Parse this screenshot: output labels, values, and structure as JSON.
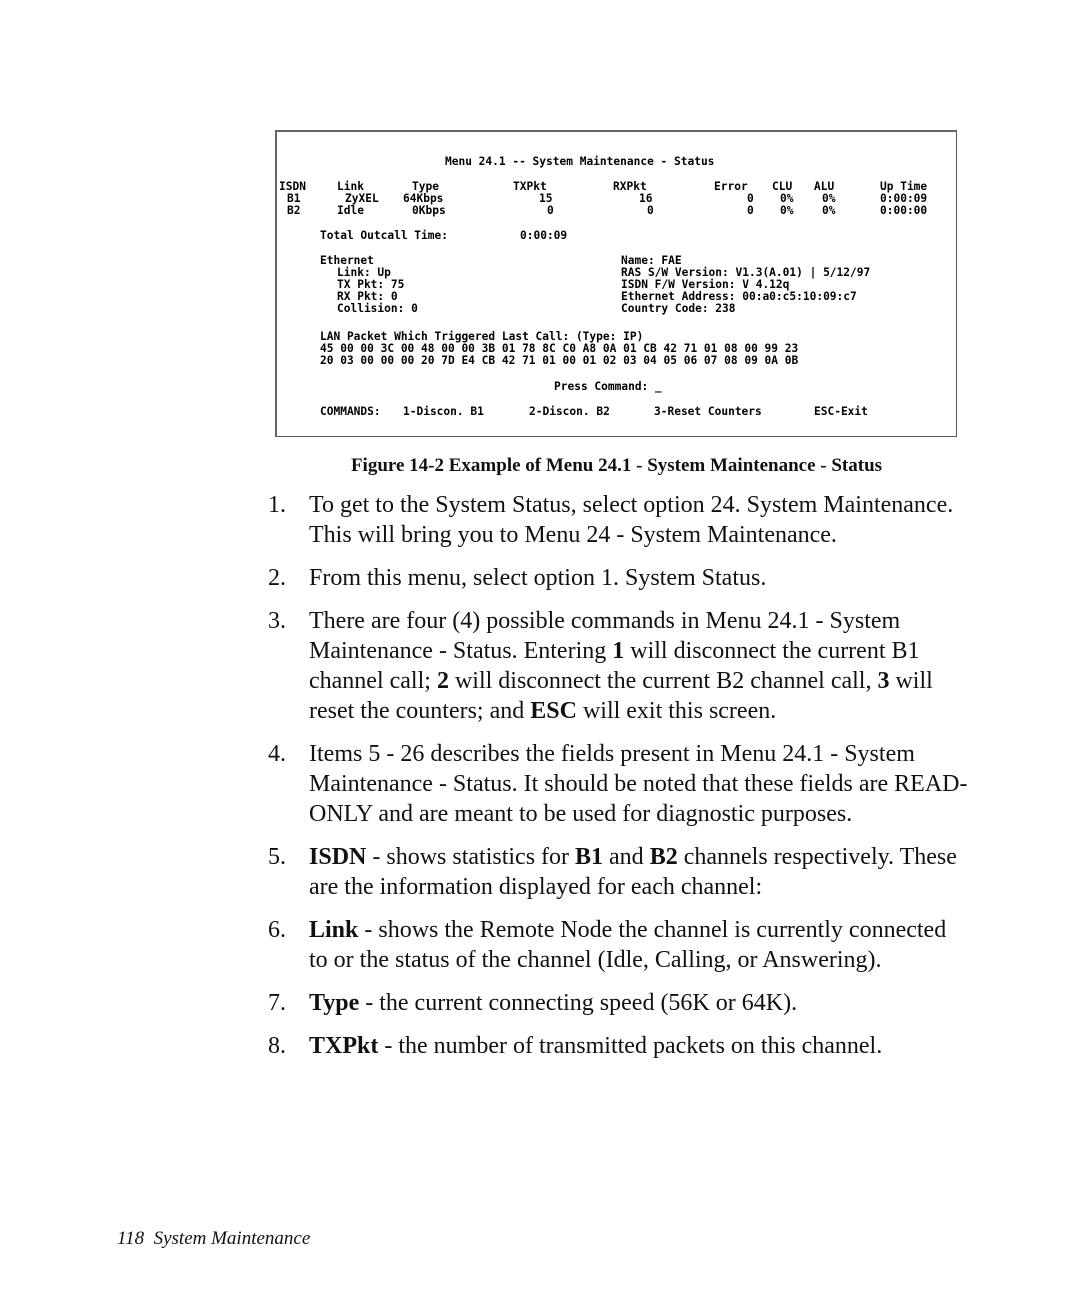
{
  "terminal": {
    "title": "Menu 24.1 -- System Maintenance - Status",
    "isdn_table": {
      "headers": [
        "ISDN",
        "Link",
        "Type",
        "TXPkt",
        "RXPkt",
        "Error",
        "CLU",
        "ALU",
        "Up Time"
      ],
      "rows": [
        [
          "B1",
          "ZyXEL",
          "64Kbps",
          "15",
          "16",
          "0",
          "0%",
          "0%",
          "0:00:09"
        ],
        [
          "B2",
          "Idle",
          "0Kbps",
          "0",
          "0",
          "0",
          "0%",
          "0%",
          "0:00:00"
        ]
      ]
    },
    "total_outcall_label": "Total Outcall Time:",
    "total_outcall_value": "0:00:09",
    "ethernet": {
      "heading": "Ethernet",
      "link": "Link: Up",
      "tx_pkt": "TX Pkt: 75",
      "rx_pkt": "RX Pkt: 0",
      "collision": "Collision: 0"
    },
    "system_info": {
      "name": "Name: FAE",
      "ras_version": "RAS S/W Version: V1.3(A.01) | 5/12/97",
      "isdn_fw_version": "ISDN F/W Version: V 4.12q",
      "ethernet_address": "Ethernet Address: 00:a0:c5:10:09:c7",
      "country_code": "Country Code: 238"
    },
    "lan_packet_label": "LAN Packet Which Triggered Last Call: (Type: IP)",
    "lan_packet_hex": [
      "45 00 00 3C 00 48 00 00 3B 01 78 8C C0 A8 0A 01 CB 42 71 01 08 00 99 23",
      "20 03 00 00 00 20 7D E4 CB 42 71 01 00 01 02 03 04 05 06 07 08 09 0A 0B"
    ],
    "prompt": "Press Command: _",
    "commands_label": "COMMANDS:",
    "commands": [
      "1-Discon. B1",
      "2-Discon. B2",
      "3-Reset Counters",
      "ESC-Exit"
    ]
  },
  "caption": "Figure 14-2 Example of Menu 24.1 - System Maintenance - Status",
  "steps": [
    {
      "num": "1.",
      "parts": [
        {
          "t": "To get to the System Status, select option 24. System Maintenance. This will bring you to Menu 24 - System Maintenance."
        }
      ]
    },
    {
      "num": "2.",
      "parts": [
        {
          "t": "From this menu, select option 1. System Status."
        }
      ]
    },
    {
      "num": "3.",
      "parts": [
        {
          "t": "There are four (4) possible commands in Menu 24.1 - System Maintenance - Status. Entering "
        },
        {
          "b": "1"
        },
        {
          "t": " will disconnect the current B1 channel call; "
        },
        {
          "b": "2"
        },
        {
          "t": " will disconnect the current B2 channel call, "
        },
        {
          "b": "3"
        },
        {
          "t": " will reset the counters; and "
        },
        {
          "b": "ESC"
        },
        {
          "t": " will exit this screen."
        }
      ]
    },
    {
      "num": "4.",
      "parts": [
        {
          "t": "Items 5 - 26 describes the fields present in Menu 24.1 - System Maintenance - Status. It should be noted that these fields are READ-ONLY and are meant to be used for diagnostic purposes."
        }
      ]
    },
    {
      "num": "5.",
      "parts": [
        {
          "b": "ISDN"
        },
        {
          "t": " - shows statistics for "
        },
        {
          "b": "B1"
        },
        {
          "t": " and "
        },
        {
          "b": "B2"
        },
        {
          "t": " channels respectively. These are the information displayed for each channel:"
        }
      ]
    },
    {
      "num": "6.",
      "parts": [
        {
          "b": "Link"
        },
        {
          "t": " - shows the Remote Node the channel is currently connected to or the status of the channel (Idle, Calling, or Answering)."
        }
      ]
    },
    {
      "num": "7.",
      "parts": [
        {
          "b": "Type"
        },
        {
          "t": " - the current connecting speed (56K or 64K)."
        }
      ]
    },
    {
      "num": "8.",
      "parts": [
        {
          "b": "TXPkt"
        },
        {
          "t": " - the number of transmitted packets on this channel."
        }
      ]
    }
  ],
  "footer": {
    "page_number": "118",
    "section": "System Maintenance"
  }
}
